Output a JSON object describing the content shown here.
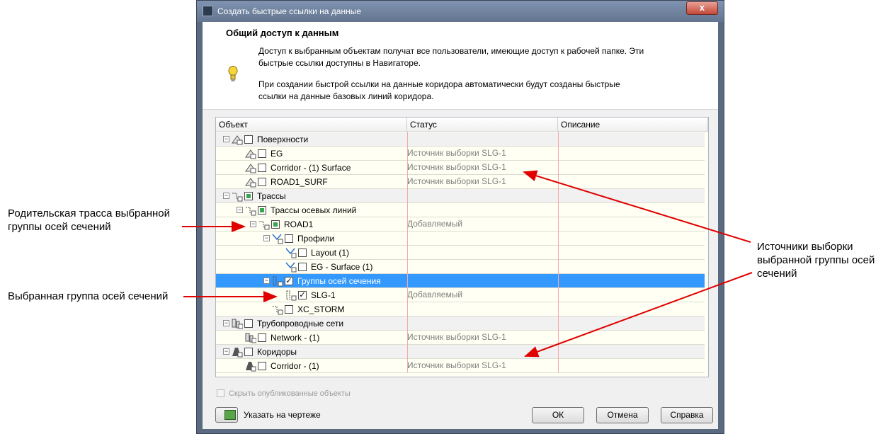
{
  "annotations": {
    "parent_alignment": [
      "Родительская трасса выбранной",
      "группы осей сечений"
    ],
    "selected_group": "Выбранная группа осей сечений",
    "sources": [
      "Источники выборки",
      "выбранной группы осей",
      "сечений"
    ]
  },
  "dialog": {
    "title": "Создать быстрые ссылки на данные",
    "close_glyph": "x",
    "header_title": "Общий доступ к данным",
    "info_1": [
      "Доступ к выбранным объектам получат все пользователи, имеющие доступ к рабочей папке. Эти",
      "быстрые ссылки доступны в Навигаторе."
    ],
    "info_2": [
      "При создании быстрой ссылки на данные коридора автоматически будут созданы быстрые",
      "ссылки на данные базовых линий коридора."
    ]
  },
  "grid": {
    "columns": [
      "Объект",
      "Статус",
      "Описание"
    ],
    "rows": [
      {
        "label": "Поверхности",
        "status": "",
        "group": true,
        "check": "empty",
        "icon": "surface-icon",
        "expander": "minus"
      },
      {
        "label": "EG",
        "status": "Источник выборки SLG-1",
        "check": "empty",
        "icon": "surface-icon"
      },
      {
        "label": "Corridor - (1) Surface",
        "status": "Источник выборки SLG-1",
        "check": "empty",
        "icon": "surface-icon"
      },
      {
        "label": "ROAD1_SURF",
        "status": "Источник выборки SLG-1",
        "check": "empty",
        "icon": "surface-icon"
      },
      {
        "label": "Трассы",
        "status": "",
        "group": true,
        "check": "partial",
        "icon": "alignment-icon",
        "expander": "minus"
      },
      {
        "label": "Трассы осевых линий",
        "status": "",
        "check": "partial",
        "icon": "alignment-icon",
        "expander": "minus"
      },
      {
        "label": "ROAD1",
        "status": "Добавляемый",
        "check": "partial",
        "icon": "alignment-icon",
        "expander": "minus"
      },
      {
        "label": "Профили",
        "status": "",
        "check": "empty",
        "icon": "profile-icon",
        "expander": "minus"
      },
      {
        "label": "Layout (1)",
        "status": "",
        "check": "empty",
        "icon": "profile-icon"
      },
      {
        "label": "EG - Surface (1)",
        "status": "",
        "check": "empty",
        "icon": "profile-icon"
      },
      {
        "label": "Группы осей сечения",
        "status": "",
        "check": "checked",
        "icon": "sample-line-group-icon",
        "expander": "minus",
        "selected": true
      },
      {
        "label": "SLG-1",
        "status": "Добавляемый",
        "check": "checked",
        "icon": "sample-line-group-icon"
      },
      {
        "label": "XC_STORM",
        "status": "",
        "check": "empty",
        "icon": "alignment-icon"
      },
      {
        "label": "Трубопроводные сети",
        "status": "",
        "group": true,
        "check": "empty",
        "icon": "pipe-network-icon",
        "expander": "minus"
      },
      {
        "label": "Network - (1)",
        "status": "Источник выборки SLG-1",
        "check": "empty",
        "icon": "pipe-network-icon"
      },
      {
        "label": "Коридоры",
        "status": "",
        "group": true,
        "check": "empty",
        "icon": "corridor-icon",
        "expander": "minus"
      },
      {
        "label": "Corridor - (1)",
        "status": "Источник выборки SLG-1",
        "check": "empty",
        "icon": "corridor-icon"
      }
    ],
    "checked_glyph": "✓",
    "expander_glyph": "−"
  },
  "footer": {
    "hide_published": "Скрыть опубликованные объекты",
    "pick": "Указать на чертеже",
    "ok": "ОК",
    "cancel": "Отмена",
    "help": "Справка"
  },
  "colors": {
    "selection": "#3399ff",
    "arrow": "#e00000",
    "grid_background": "#fffff3"
  }
}
